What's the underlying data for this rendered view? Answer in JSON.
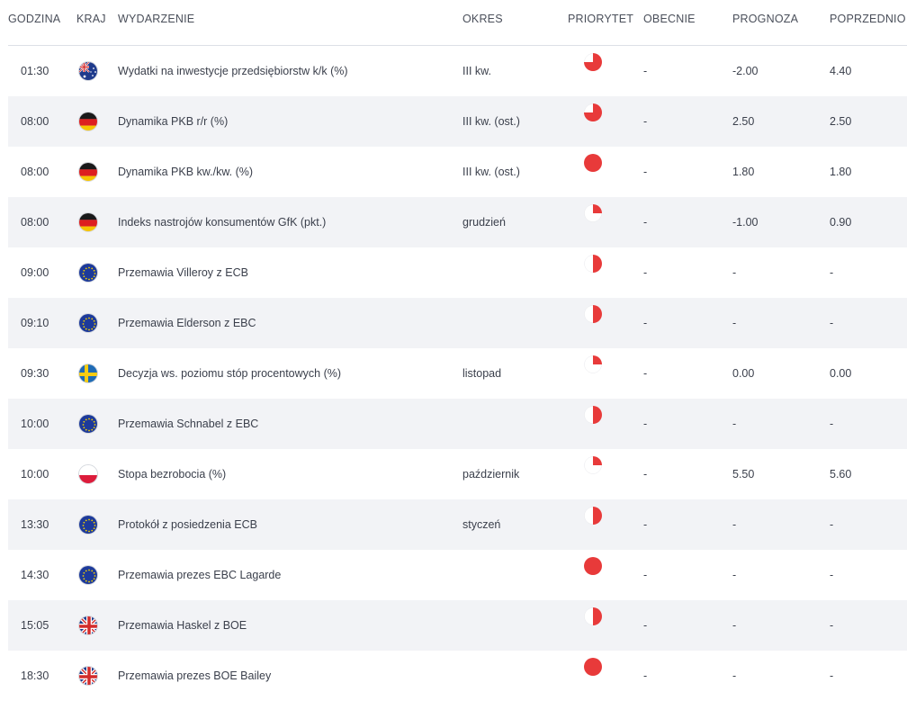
{
  "headers": {
    "time": "GODZINA",
    "country": "KRAJ",
    "event": "WYDARZENIE",
    "period": "OKRES",
    "priority": "PRIORYTET",
    "actual": "OBECNIE",
    "forecast": "PROGNOZA",
    "previous": "POPRZEDNIO"
  },
  "colors": {
    "priority": "#e83a3a",
    "row_alt": "#f2f3f6"
  },
  "rows": [
    {
      "time": "01:30",
      "flag": "australia-flag-icon",
      "event": "Wydatki na inwestycje przedsiębiorstw k/k (%)",
      "period": "III kw.",
      "priority": 0.75,
      "actual": "-",
      "forecast": "-2.00",
      "previous": "4.40"
    },
    {
      "time": "08:00",
      "flag": "germany-flag-icon",
      "event": "Dynamika PKB r/r (%)",
      "period": "III kw. (ost.)",
      "priority": 0.75,
      "actual": "-",
      "forecast": "2.50",
      "previous": "2.50"
    },
    {
      "time": "08:00",
      "flag": "germany-flag-icon",
      "event": "Dynamika PKB kw./kw. (%)",
      "period": "III kw. (ost.)",
      "priority": 1.0,
      "actual": "-",
      "forecast": "1.80",
      "previous": "1.80"
    },
    {
      "time": "08:00",
      "flag": "germany-flag-icon",
      "event": "Indeks nastrojów konsumentów GfK (pkt.)",
      "period": "grudzień",
      "priority": 0.25,
      "actual": "-",
      "forecast": "-1.00",
      "previous": "0.90"
    },
    {
      "time": "09:00",
      "flag": "eu-flag-icon",
      "event": "Przemawia Villeroy z ECB",
      "period": "",
      "priority": 0.5,
      "actual": "-",
      "forecast": "-",
      "previous": "-"
    },
    {
      "time": "09:10",
      "flag": "eu-flag-icon",
      "event": "Przemawia Elderson z EBC",
      "period": "",
      "priority": 0.5,
      "actual": "-",
      "forecast": "-",
      "previous": "-"
    },
    {
      "time": "09:30",
      "flag": "sweden-flag-icon",
      "event": "Decyzja ws. poziomu stóp procentowych (%)",
      "period": "listopad",
      "priority": 0.25,
      "actual": "-",
      "forecast": "0.00",
      "previous": "0.00"
    },
    {
      "time": "10:00",
      "flag": "eu-flag-icon",
      "event": "Przemawia Schnabel z EBC",
      "period": "",
      "priority": 0.5,
      "actual": "-",
      "forecast": "-",
      "previous": "-"
    },
    {
      "time": "10:00",
      "flag": "poland-flag-icon",
      "event": "Stopa bezrobocia (%)",
      "period": "październik",
      "priority": 0.25,
      "actual": "-",
      "forecast": "5.50",
      "previous": "5.60"
    },
    {
      "time": "13:30",
      "flag": "eu-flag-icon",
      "event": "Protokół z posiedzenia ECB",
      "period": "styczeń",
      "priority": 0.5,
      "actual": "-",
      "forecast": "-",
      "previous": "-"
    },
    {
      "time": "14:30",
      "flag": "eu-flag-icon",
      "event": "Przemawia prezes EBC Lagarde",
      "period": "",
      "priority": 1.0,
      "actual": "-",
      "forecast": "-",
      "previous": "-"
    },
    {
      "time": "15:05",
      "flag": "uk-flag-icon",
      "event": "Przemawia Haskel z BOE",
      "period": "",
      "priority": 0.5,
      "actual": "-",
      "forecast": "-",
      "previous": "-"
    },
    {
      "time": "18:30",
      "flag": "uk-flag-icon",
      "event": "Przemawia prezes BOE Bailey",
      "period": "",
      "priority": 1.0,
      "actual": "-",
      "forecast": "-",
      "previous": "-"
    }
  ]
}
